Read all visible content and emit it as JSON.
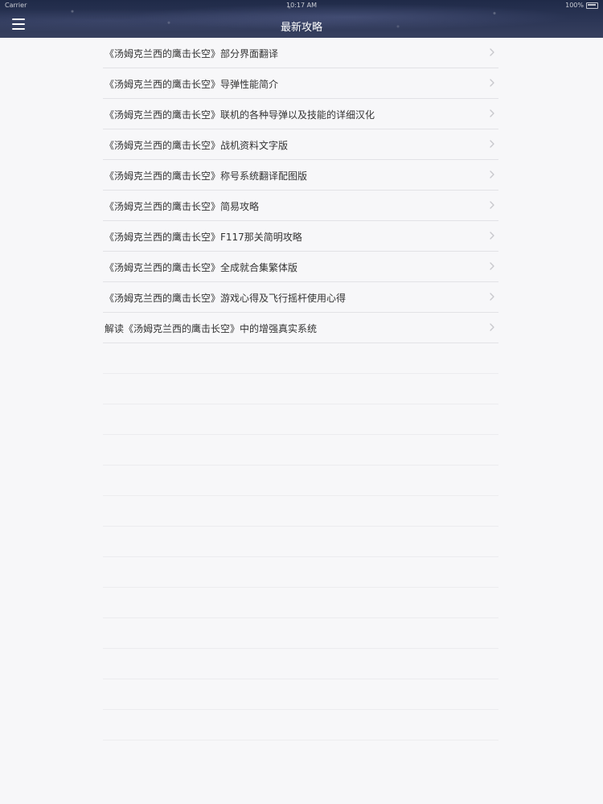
{
  "status_bar": {
    "carrier": "Carrier",
    "time": "10:17 AM",
    "battery": "100%"
  },
  "nav": {
    "title": "最新攻略",
    "menu_icon": "hamburger-menu-icon"
  },
  "articles": [
    {
      "label": "《汤姆克兰西的鹰击长空》部分界面翻译"
    },
    {
      "label": "《汤姆克兰西的鹰击长空》导弹性能简介"
    },
    {
      "label": "《汤姆克兰西的鹰击长空》联机的各种导弹以及技能的详细汉化"
    },
    {
      "label": "《汤姆克兰西的鹰击长空》战机资料文字版"
    },
    {
      "label": "《汤姆克兰西的鹰击长空》称号系统翻译配图版"
    },
    {
      "label": "《汤姆克兰西的鹰击长空》简易攻略"
    },
    {
      "label": "《汤姆克兰西的鹰击长空》F117那关简明攻略"
    },
    {
      "label": "《汤姆克兰西的鹰击长空》全成就合集繁体版"
    },
    {
      "label": "《汤姆克兰西的鹰击长空》游戏心得及飞行摇杆使用心得"
    },
    {
      "label": "解读《汤姆克兰西的鹰击长空》中的增强真实系统"
    }
  ],
  "colors": {
    "header_bg": "#2c3656",
    "text": "#333333",
    "separator": "#e2e2e6",
    "chevron": "#c7c7cc"
  }
}
